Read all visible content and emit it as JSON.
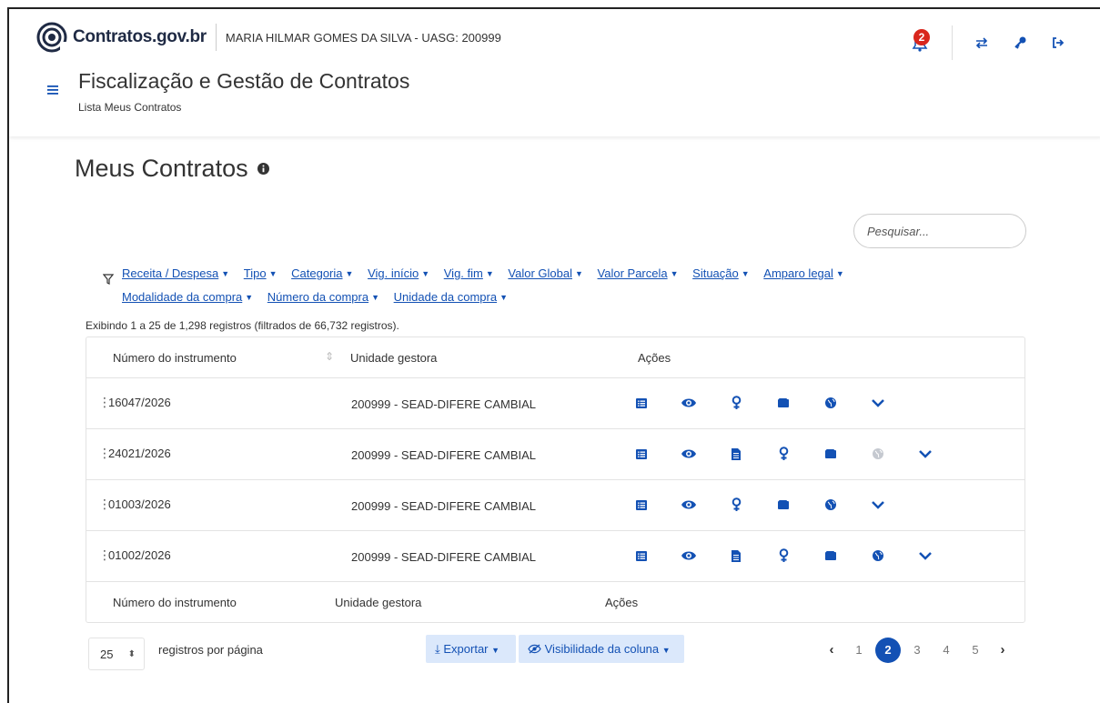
{
  "header": {
    "logo_text": "Contratos.gov.br",
    "user_info": "MARIA HILMAR GOMES DA SILVA - UASG: 200999",
    "notification_count": "2",
    "title": "Fiscalização e Gestão de Contratos",
    "breadcrumb": "Lista Meus Contratos",
    "icons": [
      "bell-icon",
      "switch-icon",
      "key-icon",
      "logout-icon"
    ]
  },
  "main": {
    "title": "Meus Contratos",
    "search_placeholder": "Pesquisar...",
    "filters": [
      "Receita / Despesa",
      "Tipo",
      "Categoria",
      "Vig. início",
      "Vig. fim",
      "Valor Global",
      "Valor Parcela",
      "Situação",
      "Amparo legal",
      "Modalidade da compra",
      "Número da compra",
      "Unidade da compra"
    ],
    "info_count": "Exibindo 1 a 25 de 1,298 registros (filtrados de 66,732 registros)."
  },
  "table": {
    "columns": [
      "Número do instrumento",
      "Unidade gestora",
      "Ações"
    ],
    "rows": [
      {
        "numero": "16047/2026",
        "unidade": "200999 - SEAD-DIFERE CAMBIAL",
        "actions": [
          "list-icon",
          "eye-icon",
          "female-icon",
          "wallet-icon",
          "globe-icon",
          "chevron-down-icon"
        ]
      },
      {
        "numero": "24021/2026",
        "unidade": "200999 - SEAD-DIFERE CAMBIAL",
        "actions": [
          "list-icon",
          "eye-icon",
          "document-icon",
          "female-icon",
          "wallet-icon",
          "globe-icon",
          "chevron-down-icon"
        ]
      },
      {
        "numero": "01003/2026",
        "unidade": "200999 - SEAD-DIFERE CAMBIAL",
        "actions": [
          "list-icon",
          "eye-icon",
          "female-icon",
          "wallet-icon",
          "globe-icon",
          "chevron-down-icon"
        ]
      },
      {
        "numero": "01002/2026",
        "unidade": "200999 - SEAD-DIFERE CAMBIAL",
        "actions": [
          "list-icon",
          "eye-icon",
          "document-icon",
          "female-icon",
          "wallet-icon",
          "globe-icon",
          "chevron-down-icon"
        ]
      }
    ]
  },
  "footer": {
    "per_page": "25",
    "per_page_label": "registros por página",
    "export_label": "Exportar",
    "visibility_label": "Visibilidade da coluna",
    "pages": [
      "1",
      "2",
      "3",
      "4",
      "5"
    ],
    "current_page": "2"
  },
  "colors": {
    "primary": "#1351b4",
    "badge": "#d9261c",
    "button_bg": "#dbe8fb",
    "globe_disabled": "#c5c9d0"
  }
}
